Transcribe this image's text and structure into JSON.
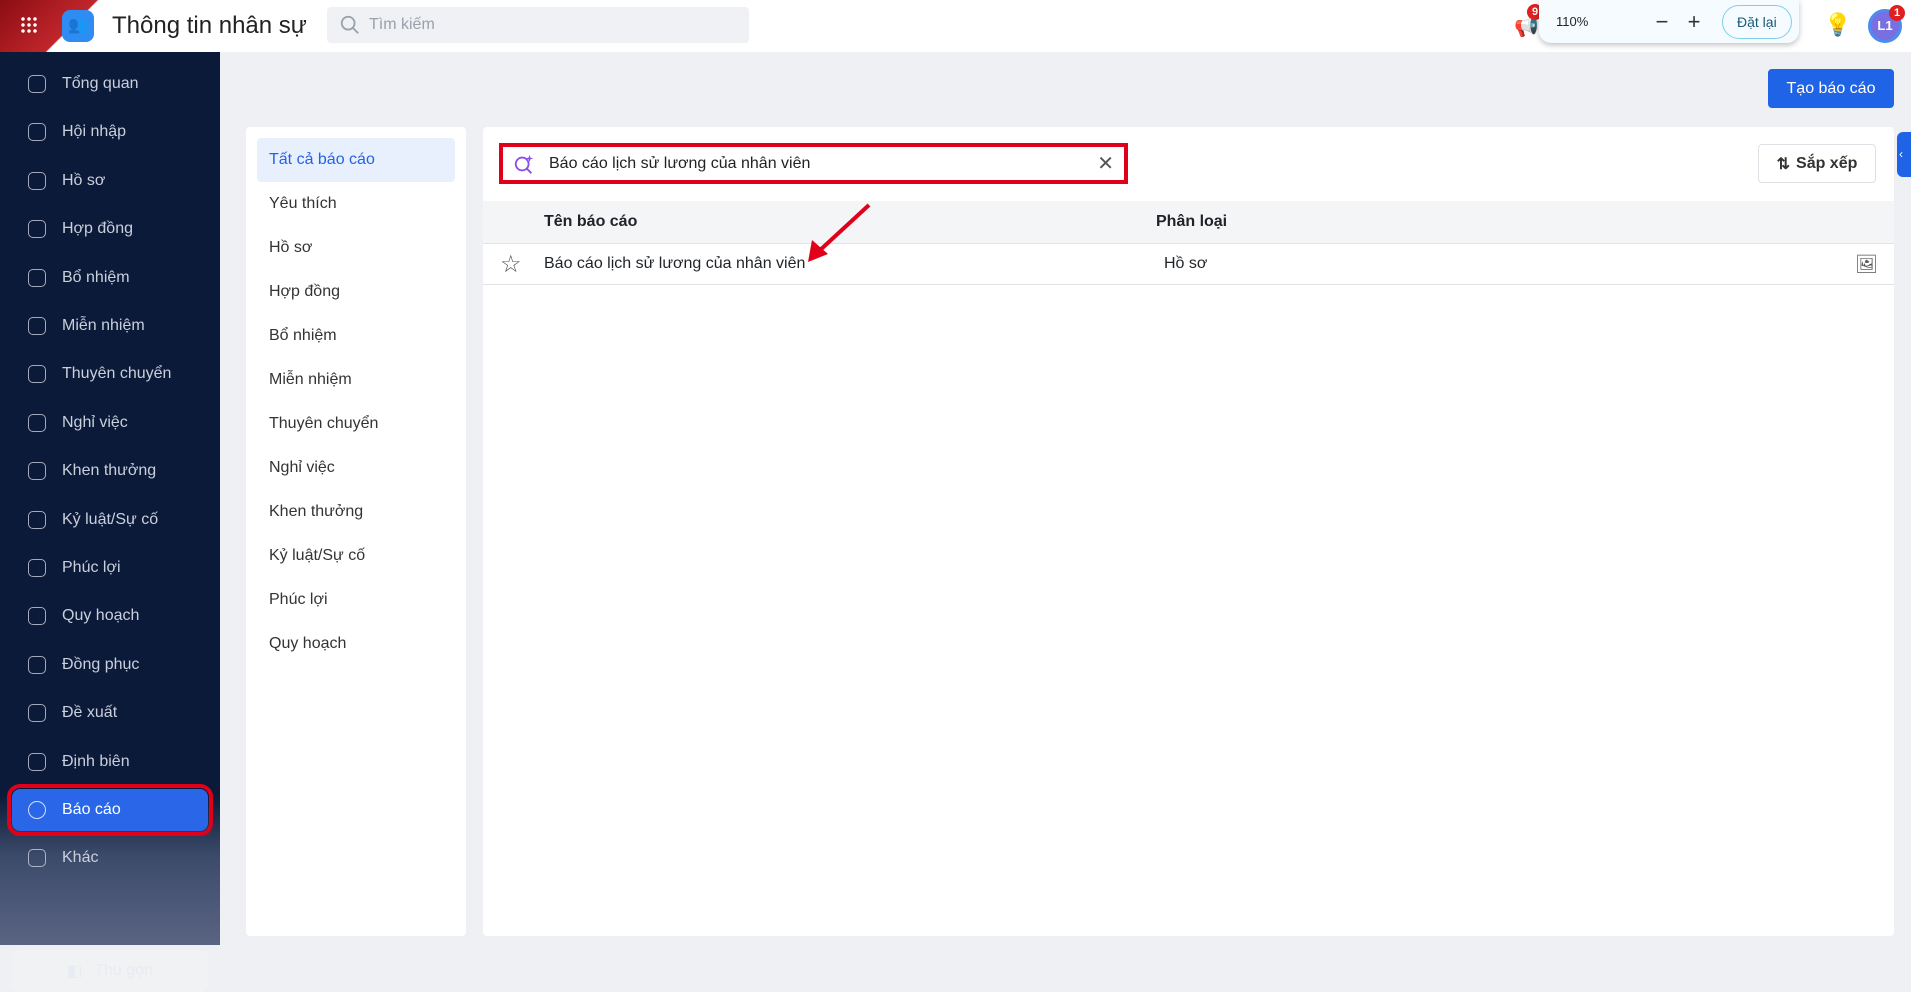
{
  "header": {
    "title": "Thông tin nhân sự",
    "search_placeholder": "Tìm kiếm",
    "zoom_level": "110%",
    "zoom_out": "−",
    "zoom_in": "+",
    "reset_label": "Đặt lại",
    "notification_count": "9",
    "avatar_initials": "L1",
    "avatar_badge": "1"
  },
  "sidebar": {
    "items": [
      {
        "label": "Tổng quan"
      },
      {
        "label": "Hội nhập"
      },
      {
        "label": "Hồ sơ"
      },
      {
        "label": "Hợp đồng"
      },
      {
        "label": "Bổ nhiệm"
      },
      {
        "label": "Miễn nhiệm"
      },
      {
        "label": "Thuyên chuyển"
      },
      {
        "label": "Nghỉ việc"
      },
      {
        "label": "Khen thưởng"
      },
      {
        "label": "Kỷ luật/Sự cố"
      },
      {
        "label": "Phúc lợi"
      },
      {
        "label": "Quy hoạch"
      },
      {
        "label": "Đồng phục"
      },
      {
        "label": "Đề xuất"
      },
      {
        "label": "Định biên"
      },
      {
        "label": "Báo cáo"
      },
      {
        "label": "Khác"
      }
    ],
    "collapse_label": "Thu gọn"
  },
  "toolbar": {
    "create_label": "Tạo báo cáo"
  },
  "categories": [
    "Tất cả báo cáo",
    "Yêu thích",
    "Hồ sơ",
    "Hợp đồng",
    "Bổ nhiệm",
    "Miễn nhiệm",
    "Thuyên chuyển",
    "Nghỉ việc",
    "Khen thưởng",
    "Kỷ luật/Sự cố",
    "Phúc lợi",
    "Quy hoạch"
  ],
  "report_search": {
    "value": "Báo cáo lịch sử lương của nhân viên"
  },
  "sort_label": "Sắp xếp",
  "table": {
    "columns": [
      "Tên báo cáo",
      "Phân loại"
    ],
    "rows": [
      {
        "name": "Báo cáo lịch sử lương của nhân viên",
        "category": "Hồ sơ"
      }
    ]
  }
}
